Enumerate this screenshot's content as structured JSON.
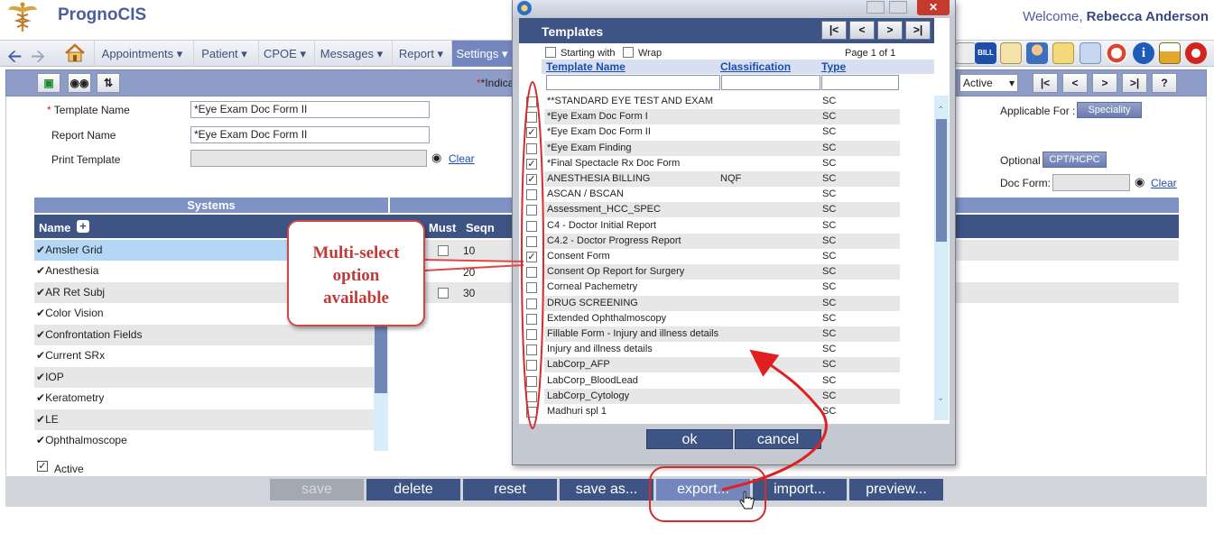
{
  "header": {
    "app_title": "PrognoCIS",
    "welcome_prefix": "Welcome,",
    "user_name": "Rebecca Anderson"
  },
  "nav": {
    "items": [
      {
        "label": "Appointments ▾"
      },
      {
        "label": "Patient ▾"
      },
      {
        "label": "CPOE ▾"
      },
      {
        "label": "Messages ▾"
      },
      {
        "label": "Report ▾"
      },
      {
        "label": "Settings ▾"
      }
    ],
    "active": "Settings"
  },
  "toolbar": {
    "indicator_label": "*Indicat",
    "status_value": "Active",
    "status_arrow": "▾",
    "nav_buttons": [
      "|<",
      "<",
      ">",
      ">|",
      "?"
    ]
  },
  "form": {
    "template_name_label": "Template Name",
    "template_name_value": "*Eye Exam Doc Form II",
    "report_name_label": "Report Name",
    "report_name_value": "*Eye Exam Doc Form II",
    "print_template_label": "Print Template",
    "clear_label": "Clear",
    "applicable_for_label": "Applicable For :",
    "speciality_label": "Speciality",
    "optional_label": "Optional",
    "cpt_label": "CPT/HCPC",
    "doc_form_label": "Doc Form:",
    "active_label": "Active"
  },
  "systems": {
    "title": "Systems",
    "col_name": "Name",
    "col_must": "Must",
    "col_seqn": "Seqn",
    "rows": [
      "Amsler Grid",
      "Anesthesia",
      "AR Ret Subj",
      "Color Vision",
      "Confrontation Fields",
      "Current SRx",
      "IOP",
      "Keratometry",
      "LE",
      "Ophthalmoscope"
    ],
    "seqn": [
      "10",
      "20",
      "30"
    ]
  },
  "buttons": {
    "save": "save",
    "delete": "delete",
    "reset": "reset",
    "save_as": "save as...",
    "export": "export...",
    "import": "import...",
    "preview": "preview..."
  },
  "popup": {
    "title": "Templates",
    "nav_buttons": [
      "|<",
      "<",
      ">",
      ">|"
    ],
    "starting_with": "Starting with",
    "wrap": "Wrap",
    "page_info": "Page 1 of 1",
    "col_template_name": "Template Name",
    "col_classification": "Classification",
    "col_type": "Type",
    "rows": [
      {
        "name": "**STANDARD EYE TEST AND EXAM",
        "classification": "",
        "type": "SC",
        "checked": false
      },
      {
        "name": "*Eye Exam Doc Form I",
        "classification": "",
        "type": "SC",
        "checked": false
      },
      {
        "name": "*Eye Exam Doc Form II",
        "classification": "",
        "type": "SC",
        "checked": true
      },
      {
        "name": "*Eye Exam Finding",
        "classification": "",
        "type": "SC",
        "checked": false
      },
      {
        "name": "*Final Spectacle Rx Doc Form",
        "classification": "",
        "type": "SC",
        "checked": true
      },
      {
        "name": "ANESTHESIA BILLING",
        "classification": "NQF",
        "type": "SC",
        "checked": true
      },
      {
        "name": "ASCAN / BSCAN",
        "classification": "",
        "type": "SC",
        "checked": false
      },
      {
        "name": "Assessment_HCC_SPEC",
        "classification": "",
        "type": "SC",
        "checked": false
      },
      {
        "name": "C4 - Doctor Initial Report",
        "classification": "",
        "type": "SC",
        "checked": false
      },
      {
        "name": "C4.2 - Doctor Progress Report",
        "classification": "",
        "type": "SC",
        "checked": false
      },
      {
        "name": "Consent Form",
        "classification": "",
        "type": "SC",
        "checked": true
      },
      {
        "name": "Consent Op Report for Surgery",
        "classification": "",
        "type": "SC",
        "checked": false
      },
      {
        "name": "Corneal Pachemetry",
        "classification": "",
        "type": "SC",
        "checked": false
      },
      {
        "name": "DRUG SCREENING",
        "classification": "",
        "type": "SC",
        "checked": false
      },
      {
        "name": "Extended Ophthalmoscopy",
        "classification": "",
        "type": "SC",
        "checked": false
      },
      {
        "name": "Fillable Form - Injury and illness details",
        "classification": "",
        "type": "SC",
        "checked": false
      },
      {
        "name": "Injury and illness details",
        "classification": "",
        "type": "SC",
        "checked": false
      },
      {
        "name": "LabCorp_AFP",
        "classification": "",
        "type": "SC",
        "checked": false
      },
      {
        "name": "LabCorp_BloodLead",
        "classification": "",
        "type": "SC",
        "checked": false
      },
      {
        "name": "LabCorp_Cytology",
        "classification": "",
        "type": "SC",
        "checked": false
      },
      {
        "name": "Madhuri spl 1",
        "classification": "",
        "type": "SC",
        "checked": false
      }
    ],
    "ok": "ok",
    "cancel": "cancel"
  },
  "annotation": {
    "line1": "Multi-select",
    "line2": "option",
    "line3": "available"
  },
  "colors": {
    "brand": "#4a5ea0",
    "header_dark": "#3d5485",
    "nav_active": "#7486be",
    "annotation_red": "#d44444"
  }
}
